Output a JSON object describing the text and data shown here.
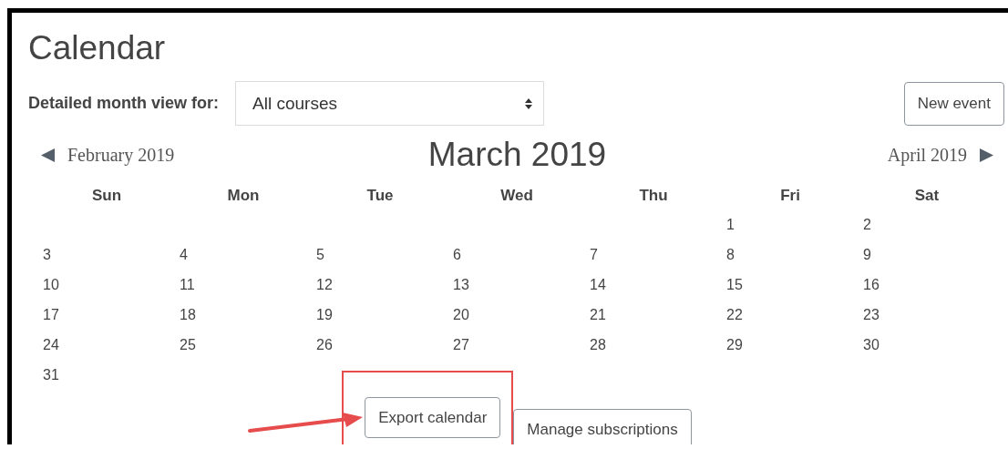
{
  "title": "Calendar",
  "filter": {
    "label": "Detailed month view for:",
    "value": "All courses"
  },
  "new_event_button": "New event",
  "navigation": {
    "previous": "February 2019",
    "current": "March 2019",
    "next": "April 2019"
  },
  "weekdays": [
    "Sun",
    "Mon",
    "Tue",
    "Wed",
    "Thu",
    "Fri",
    "Sat"
  ],
  "weeks": [
    [
      {
        "kind": "blank"
      },
      {
        "kind": "blank"
      },
      {
        "kind": "blank"
      },
      {
        "kind": "blank"
      },
      {
        "kind": "blank"
      },
      {
        "kind": "day",
        "label": "1"
      },
      {
        "kind": "day",
        "label": "2"
      }
    ],
    [
      {
        "kind": "day",
        "label": "3"
      },
      {
        "kind": "day",
        "label": "4"
      },
      {
        "kind": "day",
        "label": "5"
      },
      {
        "kind": "day",
        "label": "6"
      },
      {
        "kind": "day",
        "label": "7"
      },
      {
        "kind": "day",
        "label": "8"
      },
      {
        "kind": "day",
        "label": "9"
      }
    ],
    [
      {
        "kind": "day",
        "label": "10"
      },
      {
        "kind": "day",
        "label": "11"
      },
      {
        "kind": "day",
        "label": "12"
      },
      {
        "kind": "day",
        "label": "13"
      },
      {
        "kind": "day",
        "label": "14"
      },
      {
        "kind": "day",
        "label": "15"
      },
      {
        "kind": "day",
        "label": "16"
      }
    ],
    [
      {
        "kind": "day",
        "label": "17"
      },
      {
        "kind": "day",
        "label": "18"
      },
      {
        "kind": "day",
        "label": "19"
      },
      {
        "kind": "day",
        "label": "20"
      },
      {
        "kind": "day",
        "label": "21"
      },
      {
        "kind": "day",
        "label": "22"
      },
      {
        "kind": "day",
        "label": "23"
      }
    ],
    [
      {
        "kind": "day",
        "label": "24"
      },
      {
        "kind": "day",
        "label": "25"
      },
      {
        "kind": "day",
        "label": "26"
      },
      {
        "kind": "day",
        "label": "27"
      },
      {
        "kind": "day",
        "label": "28"
      },
      {
        "kind": "day",
        "label": "29"
      },
      {
        "kind": "day",
        "label": "30"
      }
    ],
    [
      {
        "kind": "day",
        "label": "31"
      },
      {
        "kind": "blank"
      },
      {
        "kind": "blank"
      },
      {
        "kind": "blank"
      },
      {
        "kind": "blank"
      },
      {
        "kind": "blank"
      },
      {
        "kind": "blank"
      }
    ]
  ],
  "buttons": [
    {
      "label": "Export calendar",
      "highlighted": true
    },
    {
      "label": "Manage subscriptions",
      "highlighted": false
    }
  ]
}
